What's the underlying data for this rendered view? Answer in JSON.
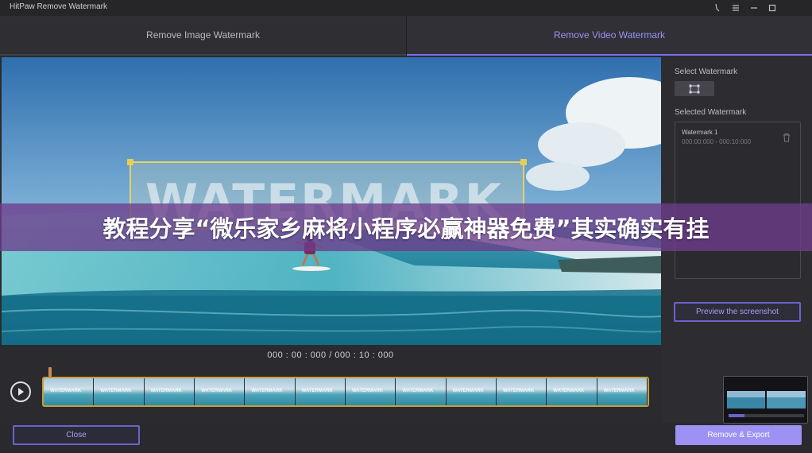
{
  "window": {
    "title": "HitPaw Remove Watermark",
    "controls": [
      "pin-icon",
      "menu-icon",
      "minimize-icon",
      "maximize-icon"
    ]
  },
  "tabs": [
    {
      "label": "Remove Image Watermark",
      "active": false
    },
    {
      "label": "Remove Video Watermark",
      "active": true
    }
  ],
  "preview": {
    "watermark_text": "WATERMARK"
  },
  "banner": {
    "text": "教程分享“微乐家乡麻将小程序必赢神器免费”其实确实有挂"
  },
  "player": {
    "timecode": "000 : 00 : 000 / 000 : 10 : 000",
    "frame_label": "WATERMARK",
    "frame_count": 12
  },
  "side": {
    "select_label": "Select Watermark",
    "selected_label": "Selected Watermark",
    "watermarks": [
      {
        "name": "Watermark 1",
        "range": "000:00:000 - 000:10:000"
      }
    ],
    "preview_button": "Preview the screenshot"
  },
  "footer": {
    "close_button": "Close",
    "export_button": "Remove & Export"
  },
  "colors": {
    "accent": "#7c6ef2",
    "export_button": "#9d91f3",
    "selection_box": "#e6d066",
    "timeline_border": "#c9a035"
  }
}
